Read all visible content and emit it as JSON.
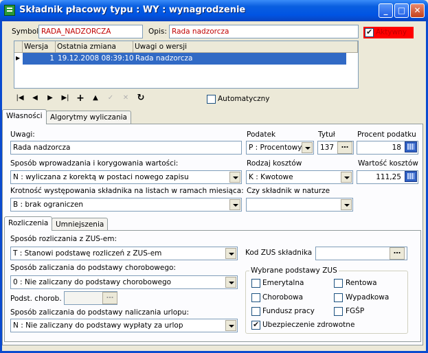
{
  "window": {
    "title": "Składnik płacowy typu : WY : wynagrodzenie",
    "min": "_",
    "max": "□",
    "close": "✕"
  },
  "header": {
    "symbol_label": "Symbol",
    "symbol_value": "RADA_NADZORCZA",
    "opis_label": "Opis:",
    "opis_value": "Rada nadzorcza",
    "aktywny_label": "Aktywny",
    "aktywny_checked": true
  },
  "versions": {
    "columns": [
      "Wersja",
      "Ostatnia zmiana",
      "Uwagi o wersji"
    ],
    "rows": [
      {
        "wersja": "1",
        "zmiana": "19.12.2008 08:39:10",
        "uwagi": "Rada nadzorcza"
      }
    ]
  },
  "toolbar": {
    "first": "|◀",
    "prev": "◀",
    "next": "▶",
    "last": "▶|",
    "add": "+",
    "up": "▲",
    "check": "✓",
    "cancel": "✕",
    "refresh": "↻",
    "automatyczny_label": "Automatyczny",
    "automatyczny_checked": false
  },
  "tabs": [
    "Własności",
    "Algorytmy wyliczania"
  ],
  "props": {
    "uwagi_label": "Uwagi:",
    "uwagi_value": "Rada nadzorcza",
    "podatek_label": "Podatek",
    "podatek_value": "P : Procentowy",
    "tytul_label": "Tytuł",
    "tytul_value": "137",
    "procent_label": "Procent podatku",
    "procent_value": "18",
    "sposob_label": "Sposób wprowadzania i korygowania wartości:",
    "sposob_value": "N : wyliczana z korektą w postaci nowego zapisu",
    "rodzaj_label": "Rodzaj kosztów",
    "rodzaj_value": "K : Kwotowe",
    "wartosc_label": "Wartość kosztów",
    "wartosc_value": "111,25",
    "krotnosc_label": "Krotność występowania składnika na listach w ramach miesiąca:",
    "krotnosc_value": "B : brak ograniczen",
    "natura_label": "Czy składnik w naturze",
    "natura_value": ""
  },
  "subtabs": [
    "Rozliczenia",
    "Umniejszenia"
  ],
  "rozl": {
    "zus_label": "Sposób rozliczania z ZUS-em:",
    "zus_value": "T : Stanowi podstawę rozliczeń z ZUS-em",
    "kod_label": "Kod ZUS składnika",
    "kod_value": "",
    "chor_label": "Sposób zaliczania do podstawy chorobowego:",
    "chor_value": "0 : Nie zaliczany do podstawy chorobowego",
    "podst_label": "Podst. chorob.",
    "podst_value": "",
    "urlop_label": "Sposób zaliczania do podstawy naliczania urlopu:",
    "urlop_value": "N : Nie zaliczany do podstawy wypłaty za urlop",
    "zus_group_label": "Wybrane podstawy ZUS",
    "checks": {
      "emerytalna": "Emerytalna",
      "rentowa": "Rentowa",
      "chorobowa": "Chorobowa",
      "wypadkowa": "Wypadkowa",
      "fp": "Fundusz pracy",
      "fgsp": "FGŚP",
      "zdrowotne": "Ubezpieczenie zdrowotne"
    },
    "zdrowotne_checked": true
  },
  "colors": {
    "accent": "#0054e3",
    "selection": "#316ac5",
    "error_red": "#ff0000"
  }
}
